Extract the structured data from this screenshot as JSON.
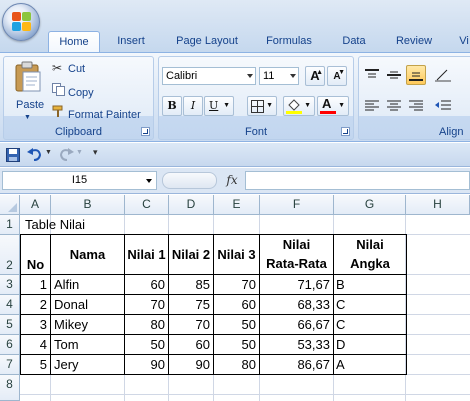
{
  "ribbon": {
    "tabs": [
      "Home",
      "Insert",
      "Page Layout",
      "Formulas",
      "Data",
      "Review",
      "Vi"
    ],
    "active_tab": "Home",
    "clipboard": {
      "paste_label": "Paste",
      "cut_label": "Cut",
      "copy_label": "Copy",
      "format_painter_label": "Format Painter",
      "group_label": "Clipboard"
    },
    "font": {
      "family": "Calibri",
      "size": "11",
      "grow_label": "A",
      "shrink_label": "A",
      "bold_label": "B",
      "italic_label": "I",
      "underline_label": "U",
      "font_color_label": "A",
      "group_label": "Font"
    },
    "alignment": {
      "group_label": "Align"
    },
    "colors": {
      "accent": "#15428b",
      "highlight": "#ffff00",
      "font_color": "#ff0000"
    }
  },
  "formula_bar": {
    "name_box": "I15",
    "fx_label": "fx",
    "formula": ""
  },
  "sheet": {
    "columns": [
      "A",
      "B",
      "C",
      "D",
      "E",
      "F",
      "G",
      "H"
    ],
    "rows": [
      "1",
      "2",
      "3",
      "4",
      "5",
      "6",
      "7",
      "8"
    ],
    "title": "Table Nilai",
    "headers": {
      "no": "No",
      "nama": "Nama",
      "nilai1": "Nilai 1",
      "nilai2": "Nilai 2",
      "nilai3": "Nilai 3",
      "rata_line1": "Nilai",
      "rata_line2": "Rata-Rata",
      "angka_line1": "Nilai",
      "angka_line2": "Angka"
    },
    "data": [
      {
        "no": "1",
        "nama": "Alfin",
        "n1": "60",
        "n2": "85",
        "n3": "70",
        "rata": "71,67",
        "angka": "B"
      },
      {
        "no": "2",
        "nama": "Donal",
        "n1": "70",
        "n2": "75",
        "n3": "60",
        "rata": "68,33",
        "angka": "C"
      },
      {
        "no": "3",
        "nama": "Mikey",
        "n1": "80",
        "n2": "70",
        "n3": "50",
        "rata": "66,67",
        "angka": "C"
      },
      {
        "no": "4",
        "nama": "Tom",
        "n1": "50",
        "n2": "60",
        "n3": "50",
        "rata": "53,33",
        "angka": "D"
      },
      {
        "no": "5",
        "nama": "Jery",
        "n1": "90",
        "n2": "90",
        "n3": "80",
        "rata": "86,67",
        "angka": "A"
      }
    ]
  }
}
